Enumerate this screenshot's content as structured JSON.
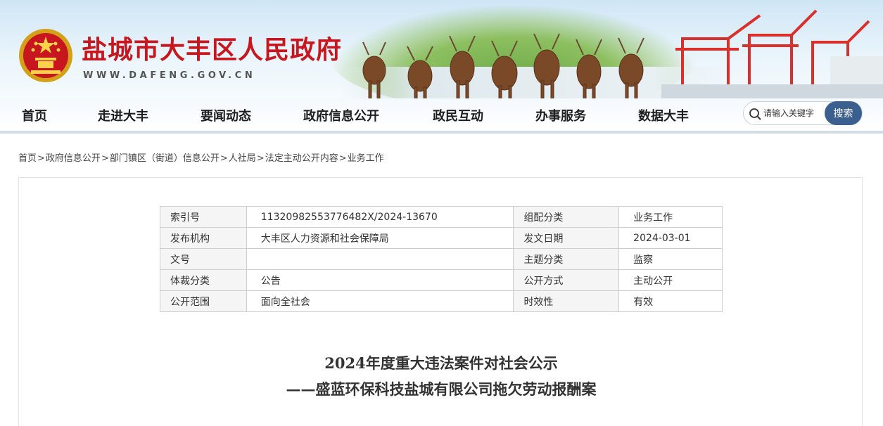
{
  "header": {
    "site_title": "盐城市大丰区人民政府",
    "site_url": "WWW.DAFENG.GOV.CN",
    "emblem_icon": "national-emblem-icon",
    "colors": {
      "title": "#c8161e",
      "search_button": "#3b5f8e"
    }
  },
  "nav": {
    "items": [
      {
        "label": "首页"
      },
      {
        "label": "走进大丰"
      },
      {
        "label": "要闻动态"
      },
      {
        "label": "政府信息公开"
      },
      {
        "label": "政民互动"
      },
      {
        "label": "办事服务"
      },
      {
        "label": "数据大丰"
      }
    ],
    "search": {
      "placeholder": "请输入关键字",
      "button_label": "搜索"
    }
  },
  "breadcrumb": {
    "items": [
      "首页",
      "政府信息公开",
      "部门镇区（街道）信息公开",
      "人社局",
      "法定主动公开内容",
      "业务工作"
    ],
    "separator": ">"
  },
  "meta_table": {
    "rows": [
      {
        "k1": "索引号",
        "v1": "11320982553776482X/2024-13670",
        "k2": "组配分类",
        "v2": "业务工作"
      },
      {
        "k1": "发布机构",
        "v1": "大丰区人力资源和社会保障局",
        "k2": "发文日期",
        "v2": "2024-03-01"
      },
      {
        "k1": "文号",
        "v1": "",
        "k2": "主题分类",
        "v2": "监察"
      },
      {
        "k1": "体裁分类",
        "v1": "公告",
        "k2": "公开方式",
        "v2": "主动公开"
      },
      {
        "k1": "公开范围",
        "v1": "面向全社会",
        "k2": "时效性",
        "v2": "有效"
      }
    ]
  },
  "article": {
    "title_line1": "2024年度重大违法案件对社会公示",
    "title_line2": "——盛蓝环保科技盐城有限公司拖欠劳动报酬案"
  }
}
